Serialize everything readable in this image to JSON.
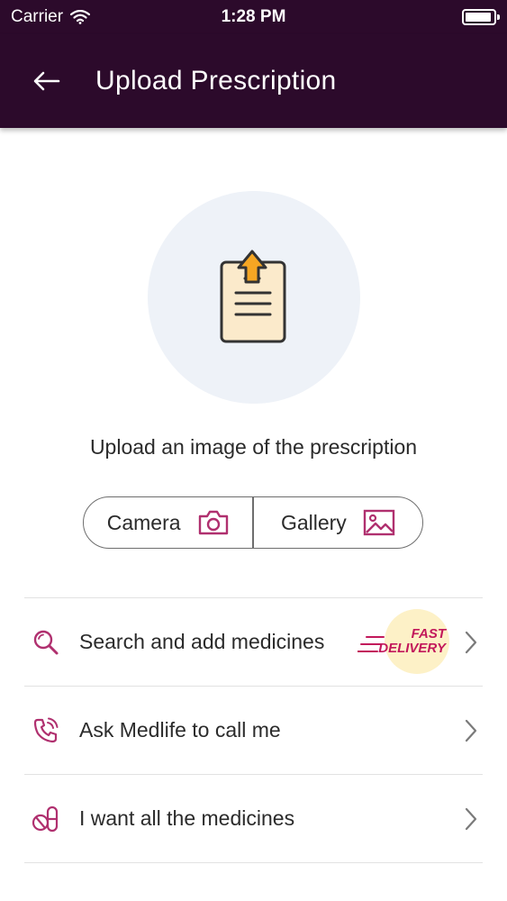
{
  "status_bar": {
    "carrier": "Carrier",
    "time": "1:28 PM"
  },
  "header": {
    "title": "Upload Prescription",
    "back_icon": "arrow-left-icon"
  },
  "hero": {
    "icon": "prescription-upload-icon",
    "caption": "Upload an image of the prescription"
  },
  "source": {
    "camera_label": "Camera",
    "camera_icon": "camera-icon",
    "gallery_label": "Gallery",
    "gallery_icon": "image-icon"
  },
  "options": [
    {
      "label": "Search and add medicines",
      "icon": "search-icon",
      "badge": {
        "line1": "FAST",
        "line2": "DELIVERY"
      }
    },
    {
      "label": "Ask Medlife to call me",
      "icon": "phone-call-icon"
    },
    {
      "label": "I want all the medicines",
      "icon": "pills-icon"
    }
  ],
  "colors": {
    "header_bg": "#2c0a2b",
    "accent": "#b0306f",
    "badge_bg": "#fdf1c7",
    "hero_bg": "#eef2f8"
  }
}
